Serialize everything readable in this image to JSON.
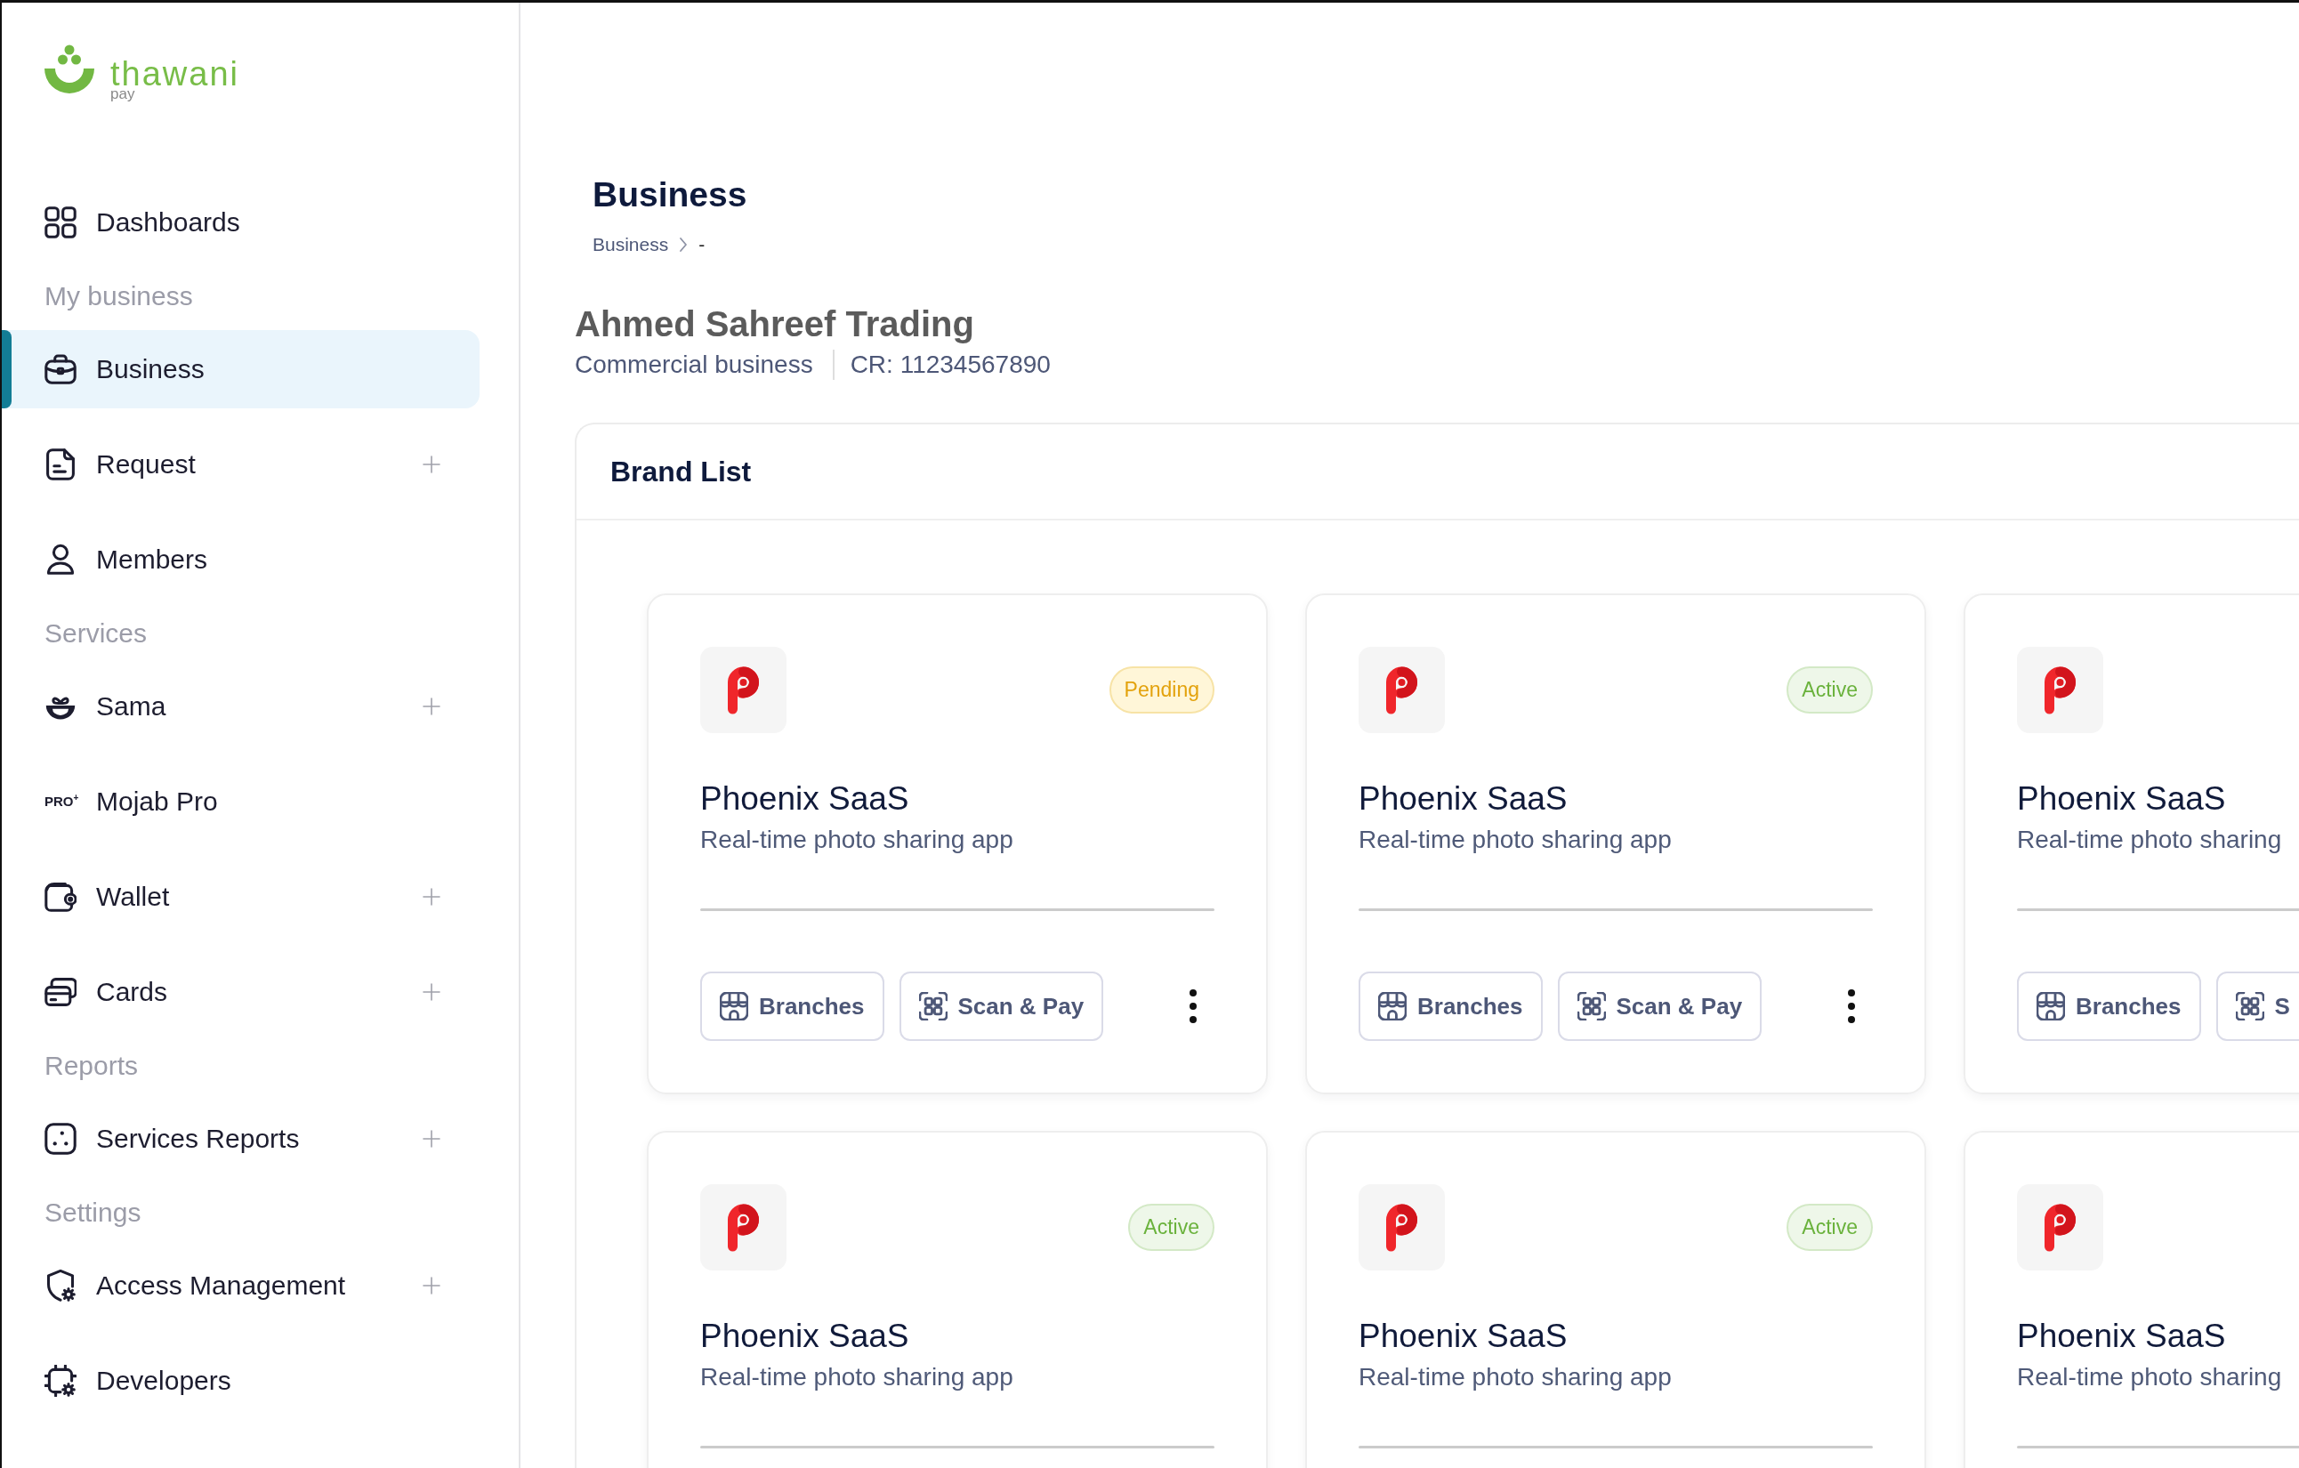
{
  "logo": {
    "name": "thawani",
    "tagline": "pay"
  },
  "sidebar": {
    "items": [
      {
        "kind": "link",
        "label": "Dashboards",
        "selected": false,
        "expandable": false
      },
      {
        "kind": "section",
        "label": "My business"
      },
      {
        "kind": "link",
        "label": "Business",
        "selected": true,
        "expandable": false
      },
      {
        "kind": "link",
        "label": "Request",
        "selected": false,
        "expandable": true
      },
      {
        "kind": "link",
        "label": "Members",
        "selected": false,
        "expandable": false
      },
      {
        "kind": "section",
        "label": "Services"
      },
      {
        "kind": "link",
        "label": "Sama",
        "selected": false,
        "expandable": true
      },
      {
        "kind": "link",
        "label": "Mojab Pro",
        "selected": false,
        "expandable": false,
        "badge": "PRO$^{+}$"
      },
      {
        "kind": "link",
        "label": "Wallet",
        "selected": false,
        "expandable": true
      },
      {
        "kind": "link",
        "label": "Cards",
        "selected": false,
        "expandable": true
      },
      {
        "kind": "section",
        "label": "Reports"
      },
      {
        "kind": "link",
        "label": "Services Reports",
        "selected": false,
        "expandable": true
      },
      {
        "kind": "section",
        "label": "Settings"
      },
      {
        "kind": "link",
        "label": "Access Management",
        "selected": false,
        "expandable": true
      },
      {
        "kind": "link",
        "label": "Developers",
        "selected": false,
        "expandable": false
      }
    ]
  },
  "page": {
    "title": "Business",
    "breadcrumb": [
      "Business",
      "-"
    ]
  },
  "company": {
    "name": "Ahmed Sahreef Trading",
    "type": "Commercial business",
    "registration": "CR: 11234567890"
  },
  "brand_list": {
    "title": "Brand List",
    "brands": [
      {
        "name": "Phoenix SaaS",
        "description": "Real-time photo sharing app",
        "badge": {
          "label": "Pending",
          "kind": "pending"
        },
        "actions": [
          {
            "kind": "button",
            "label": "Branches"
          },
          {
            "kind": "button",
            "label": "Scan & Pay"
          },
          {
            "kind": "menu"
          }
        ]
      },
      {
        "name": "Phoenix SaaS",
        "description": "Real-time photo sharing app",
        "badge": {
          "label": "Active",
          "kind": "active"
        },
        "actions": [
          {
            "kind": "button",
            "label": "Branches"
          },
          {
            "kind": "button",
            "label": "Scan & Pay"
          },
          {
            "kind": "menu"
          }
        ]
      },
      {
        "name": "Phoenix SaaS",
        "description": "Real-time photo sharing",
        "actions": [
          {
            "kind": "button",
            "label": "Branches"
          },
          {
            "kind": "button",
            "label": "S"
          }
        ]
      },
      {
        "name": "Phoenix SaaS",
        "description": "Real-time photo sharing app",
        "badge": {
          "label": "Active",
          "kind": "active"
        }
      },
      {
        "name": "Phoenix SaaS",
        "description": "Real-time photo sharing app",
        "badge": {
          "label": "Active",
          "kind": "active"
        }
      },
      {
        "name": "Phoenix SaaS",
        "description": "Real-time photo sharing"
      }
    ]
  }
}
